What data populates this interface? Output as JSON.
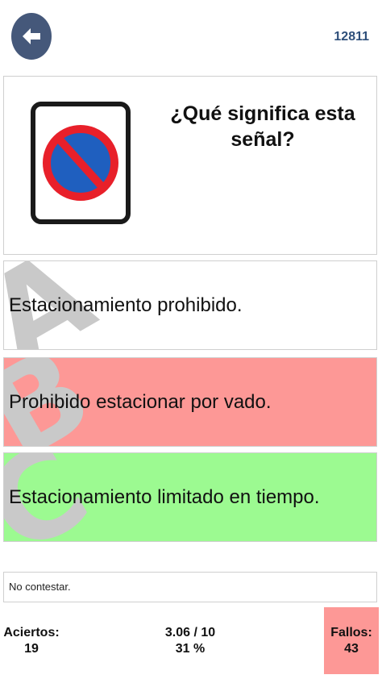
{
  "header": {
    "back_icon": "arrow-left-icon",
    "question_id": "12811"
  },
  "question": {
    "text": "¿Qué significa esta señal?",
    "sign_icon": "no-parking-sign-icon",
    "sign_colors": {
      "ring": "#e8202a",
      "fill": "#1f5fbf",
      "frame": "#1a1a1a"
    }
  },
  "answers": [
    {
      "letter": "A",
      "text": "Estacionamiento prohibido.",
      "state": "neutral",
      "color": "#ffffff"
    },
    {
      "letter": "B",
      "text": "Prohibido estacionar por vado.",
      "state": "wrong",
      "color": "#fd9896"
    },
    {
      "letter": "C",
      "text": "Estacionamiento limitado en tiempo.",
      "state": "correct",
      "color": "#9cfa91"
    }
  ],
  "no_answer": {
    "text": "No contestar."
  },
  "stats": {
    "correct_label": "Aciertos:",
    "correct_value": "19",
    "score_value": "3.06 / 10",
    "score_percent": "31 %",
    "fail_label": "Fallos:",
    "fail_value": "43"
  }
}
